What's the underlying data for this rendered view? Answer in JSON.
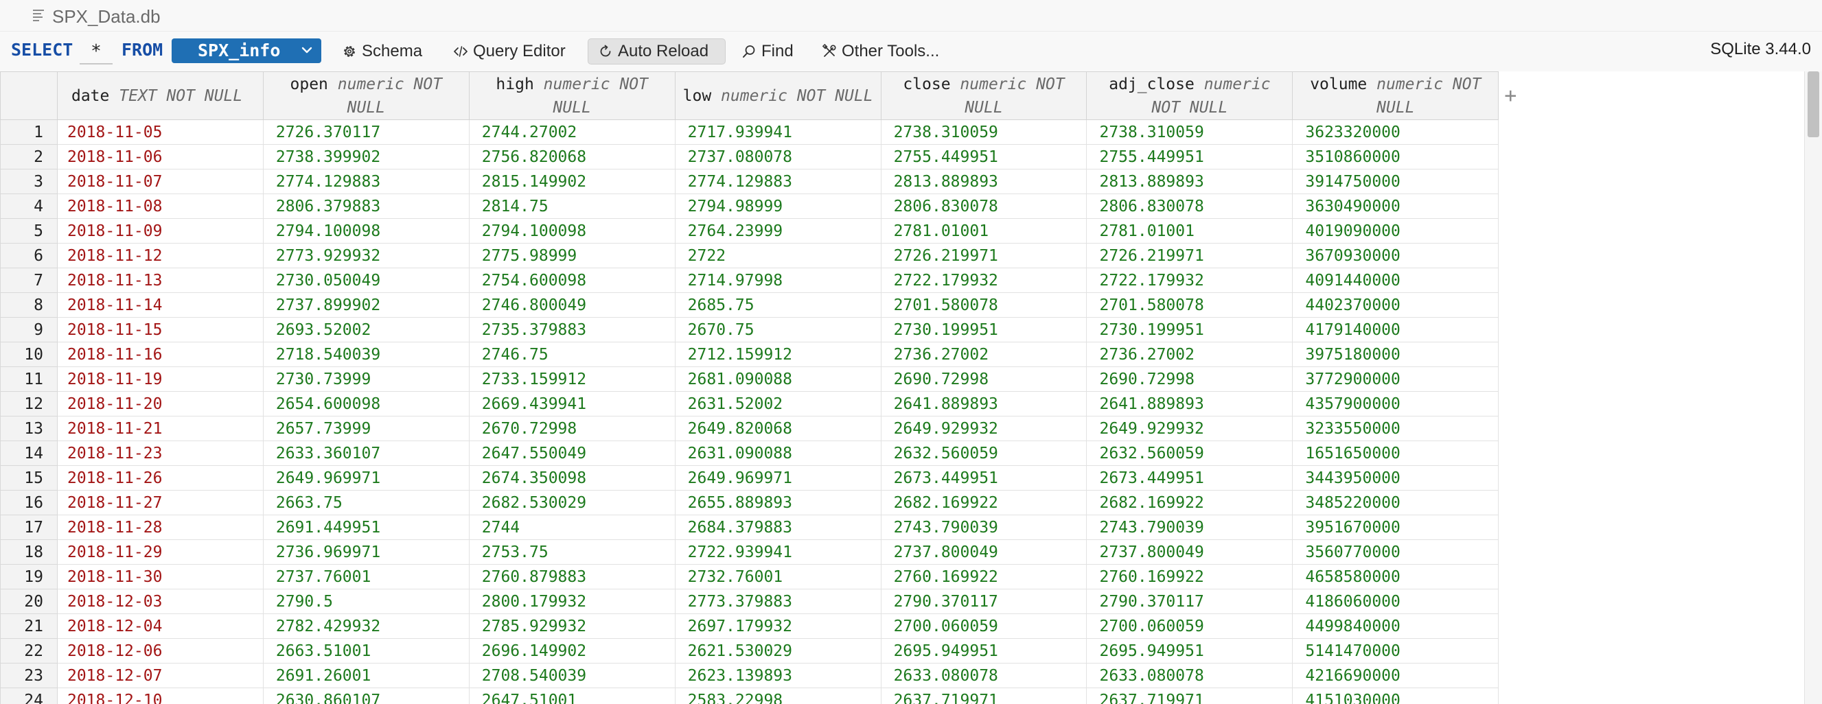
{
  "window": {
    "file_name": "SPX_Data.db"
  },
  "toolbar": {
    "select_keyword": "SELECT",
    "columns_value": "*",
    "from_keyword": "FROM",
    "table_name": "SPX_info",
    "schema_label": "Schema",
    "query_editor_label": "Query Editor",
    "auto_reload_label": "Auto Reload",
    "find_label": "Find",
    "other_tools_label": "Other Tools...",
    "version": "SQLite 3.44.0"
  },
  "grid": {
    "add_column_label": "+",
    "columns": [
      {
        "name": "date",
        "type": "TEXT NOT NULL"
      },
      {
        "name": "open",
        "type": "numeric NOT NULL"
      },
      {
        "name": "high",
        "type": "numeric NOT NULL"
      },
      {
        "name": "low",
        "type": "numeric NOT NULL"
      },
      {
        "name": "close",
        "type": "numeric NOT NULL"
      },
      {
        "name": "adj_close",
        "type": "numeric NOT NULL"
      },
      {
        "name": "volume",
        "type": "numeric NOT NULL"
      }
    ],
    "rows": [
      [
        "1",
        "2018-11-05",
        "2726.370117",
        "2744.27002",
        "2717.939941",
        "2738.310059",
        "2738.310059",
        "3623320000"
      ],
      [
        "2",
        "2018-11-06",
        "2738.399902",
        "2756.820068",
        "2737.080078",
        "2755.449951",
        "2755.449951",
        "3510860000"
      ],
      [
        "3",
        "2018-11-07",
        "2774.129883",
        "2815.149902",
        "2774.129883",
        "2813.889893",
        "2813.889893",
        "3914750000"
      ],
      [
        "4",
        "2018-11-08",
        "2806.379883",
        "2814.75",
        "2794.98999",
        "2806.830078",
        "2806.830078",
        "3630490000"
      ],
      [
        "5",
        "2018-11-09",
        "2794.100098",
        "2794.100098",
        "2764.23999",
        "2781.01001",
        "2781.01001",
        "4019090000"
      ],
      [
        "6",
        "2018-11-12",
        "2773.929932",
        "2775.98999",
        "2722",
        "2726.219971",
        "2726.219971",
        "3670930000"
      ],
      [
        "7",
        "2018-11-13",
        "2730.050049",
        "2754.600098",
        "2714.97998",
        "2722.179932",
        "2722.179932",
        "4091440000"
      ],
      [
        "8",
        "2018-11-14",
        "2737.899902",
        "2746.800049",
        "2685.75",
        "2701.580078",
        "2701.580078",
        "4402370000"
      ],
      [
        "9",
        "2018-11-15",
        "2693.52002",
        "2735.379883",
        "2670.75",
        "2730.199951",
        "2730.199951",
        "4179140000"
      ],
      [
        "10",
        "2018-11-16",
        "2718.540039",
        "2746.75",
        "2712.159912",
        "2736.27002",
        "2736.27002",
        "3975180000"
      ],
      [
        "11",
        "2018-11-19",
        "2730.73999",
        "2733.159912",
        "2681.090088",
        "2690.72998",
        "2690.72998",
        "3772900000"
      ],
      [
        "12",
        "2018-11-20",
        "2654.600098",
        "2669.439941",
        "2631.52002",
        "2641.889893",
        "2641.889893",
        "4357900000"
      ],
      [
        "13",
        "2018-11-21",
        "2657.73999",
        "2670.72998",
        "2649.820068",
        "2649.929932",
        "2649.929932",
        "3233550000"
      ],
      [
        "14",
        "2018-11-23",
        "2633.360107",
        "2647.550049",
        "2631.090088",
        "2632.560059",
        "2632.560059",
        "1651650000"
      ],
      [
        "15",
        "2018-11-26",
        "2649.969971",
        "2674.350098",
        "2649.969971",
        "2673.449951",
        "2673.449951",
        "3443950000"
      ],
      [
        "16",
        "2018-11-27",
        "2663.75",
        "2682.530029",
        "2655.889893",
        "2682.169922",
        "2682.169922",
        "3485220000"
      ],
      [
        "17",
        "2018-11-28",
        "2691.449951",
        "2744",
        "2684.379883",
        "2743.790039",
        "2743.790039",
        "3951670000"
      ],
      [
        "18",
        "2018-11-29",
        "2736.969971",
        "2753.75",
        "2722.939941",
        "2737.800049",
        "2737.800049",
        "3560770000"
      ],
      [
        "19",
        "2018-11-30",
        "2737.76001",
        "2760.879883",
        "2732.76001",
        "2760.169922",
        "2760.169922",
        "4658580000"
      ],
      [
        "20",
        "2018-12-03",
        "2790.5",
        "2800.179932",
        "2773.379883",
        "2790.370117",
        "2790.370117",
        "4186060000"
      ],
      [
        "21",
        "2018-12-04",
        "2782.429932",
        "2785.929932",
        "2697.179932",
        "2700.060059",
        "2700.060059",
        "4499840000"
      ],
      [
        "22",
        "2018-12-06",
        "2663.51001",
        "2696.149902",
        "2621.530029",
        "2695.949951",
        "2695.949951",
        "5141470000"
      ],
      [
        "23",
        "2018-12-07",
        "2691.26001",
        "2708.540039",
        "2623.139893",
        "2633.080078",
        "2633.080078",
        "4216690000"
      ],
      [
        "24",
        "2018-12-10",
        "2630.860107",
        "2647.51001",
        "2583.22998",
        "2637.719971",
        "2637.719971",
        "4151030000"
      ]
    ]
  },
  "colors": {
    "keyword": "#174ea6",
    "table_select_bg": "#1f6fb4",
    "text_value": "#a31515",
    "numeric_value": "#1d7a1d"
  }
}
